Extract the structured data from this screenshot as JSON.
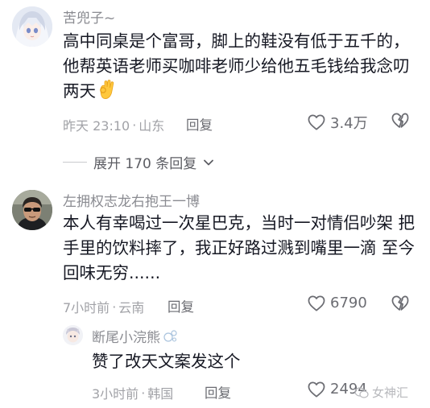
{
  "comments": [
    {
      "username": "苦兜子~",
      "text_lines": [
        "高中同桌是个富哥，脚上的鞋没有低于五千的，",
        "他帮英语老师买咖啡老师少给他五毛钱给我念叨",
        "两天"
      ],
      "trailing_emoji": "ok-hand-emoji",
      "time": "昨天 23:10",
      "location": "山东",
      "reply_label": "回复",
      "likes": "3.4万",
      "expand_label": "展开 170 条回复"
    },
    {
      "username": "左拥权志龙右抱王一博",
      "text_lines": [
        "本人有幸喝过一次星巴克，当时一对情侣吵架 把",
        "手里的饮料摔了，我正好路过溅到嘴里一滴 至今",
        "回味无穷......"
      ],
      "time": "7小时前",
      "location": "云南",
      "reply_label": "回复",
      "likes": "6790",
      "replies": [
        {
          "username": "断尾小浣熊",
          "text": "赞了改天文案发这个",
          "time": "3小时前",
          "location": "韩国",
          "reply_label": "回复",
          "likes": "2494"
        }
      ]
    }
  ],
  "watermark": "女神汇",
  "colors": {
    "text": "#161823",
    "secondary": "#8a8b91",
    "meta": "#a1a2a7"
  }
}
